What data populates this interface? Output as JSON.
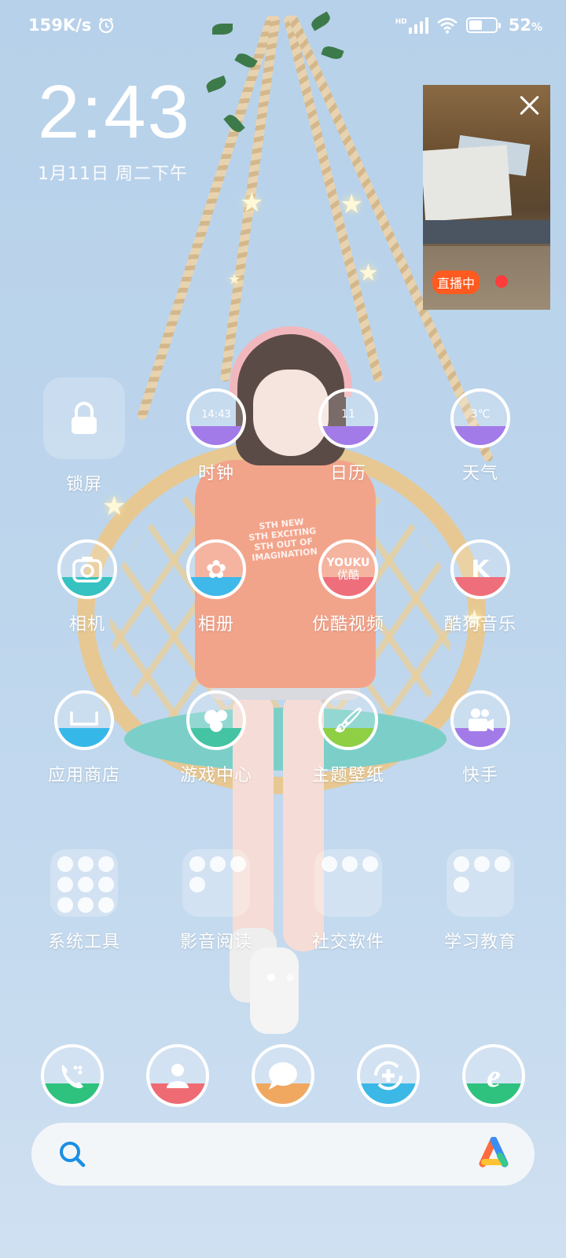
{
  "status": {
    "speed": "159K/s",
    "network": "HD",
    "battery": "52",
    "battery_unit": "%",
    "battery_level": 0.52
  },
  "clock": {
    "time": "2:43",
    "date": "1月11日 周二下午"
  },
  "live": {
    "badge": "直播中"
  },
  "apps_row1": [
    {
      "label": "锁屏",
      "icon": "lock-icon"
    },
    {
      "label": "时钟",
      "icon": "clock-icon",
      "inner": "14:43",
      "color": "#a27be8"
    },
    {
      "label": "日历",
      "icon": "calendar-icon",
      "inner": "11",
      "color": "#a27be8"
    },
    {
      "label": "天气",
      "icon": "weather-icon",
      "inner": "3℃",
      "color": "#a27be8"
    }
  ],
  "apps_row2": [
    {
      "label": "相机",
      "icon": "camera-icon",
      "color": "#35c2c0"
    },
    {
      "label": "相册",
      "icon": "gallery-icon",
      "color": "#3fb9ea"
    },
    {
      "label": "优酷视频",
      "icon": "youku-icon",
      "inner_top": "YOUKU",
      "inner_bottom": "优酷",
      "color": "#ee6f7b"
    },
    {
      "label": "酷狗音乐",
      "icon": "kugou-icon",
      "inner": "K",
      "color": "#ee6f7b"
    }
  ],
  "apps_row3": [
    {
      "label": "应用商店",
      "icon": "app-store-icon",
      "color": "#35b8e8"
    },
    {
      "label": "游戏中心",
      "icon": "game-center-icon",
      "color": "#44c4a2"
    },
    {
      "label": "主题壁纸",
      "icon": "theme-icon",
      "color": "#8ecf44"
    },
    {
      "label": "快手",
      "icon": "kuaishou-icon",
      "color": "#a27be8"
    }
  ],
  "folders": [
    {
      "label": "系统工具",
      "count": 9
    },
    {
      "label": "影音阅读",
      "count": 4
    },
    {
      "label": "社交软件",
      "count": 3
    },
    {
      "label": "学习教育",
      "count": 4
    }
  ],
  "dock": [
    {
      "icon": "phone-icon",
      "color": "#2ec27e"
    },
    {
      "icon": "contacts-icon",
      "color": "#ef6b74"
    },
    {
      "icon": "messages-icon",
      "color": "#f0a860"
    },
    {
      "icon": "browser-plus-icon",
      "color": "#3bb8e6"
    },
    {
      "icon": "ie-browser-icon",
      "color": "#2ec27e"
    }
  ],
  "search": {
    "placeholder": ""
  },
  "colors": {
    "accent": "#1a8fe3",
    "live_badge": "#ff5a1f",
    "record_dot": "#ff3b3b"
  }
}
